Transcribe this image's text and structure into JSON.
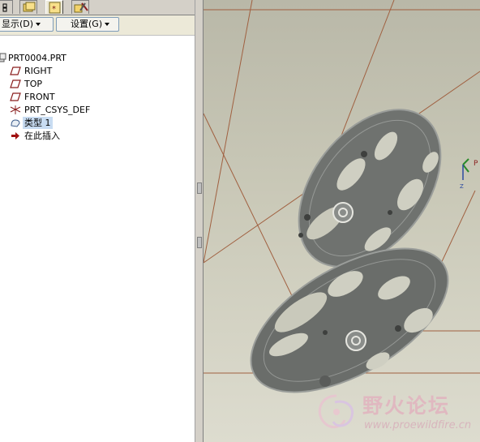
{
  "toolbar": {
    "show_label": "显示",
    "show_shortcut": "(D)",
    "settings_label": "设置",
    "settings_shortcut": "(G)"
  },
  "tree": {
    "items": [
      {
        "label": "PRT0004.PRT",
        "icon": "part-icon"
      },
      {
        "label": "RIGHT",
        "icon": "datum-plane-icon"
      },
      {
        "label": "TOP",
        "icon": "datum-plane-icon"
      },
      {
        "label": "FRONT",
        "icon": "datum-plane-icon"
      },
      {
        "label": "PRT_CSYS_DEF",
        "icon": "coordinate-system-icon"
      },
      {
        "label": "类型 1",
        "icon": "feature-icon",
        "selected": true
      },
      {
        "label": "在此插入",
        "icon": "insert-here-arrow-icon"
      }
    ]
  },
  "viewport": {
    "axis_label": "P",
    "axis_label_z": "Z"
  },
  "watermark": {
    "title": "野火论坛",
    "url": "www.proewildfire.cn"
  },
  "colors": {
    "accent": "#8a1e1e",
    "datum_line": "#a0522d",
    "part_gray": "#6e716e",
    "selection": "#c8dcf2"
  }
}
